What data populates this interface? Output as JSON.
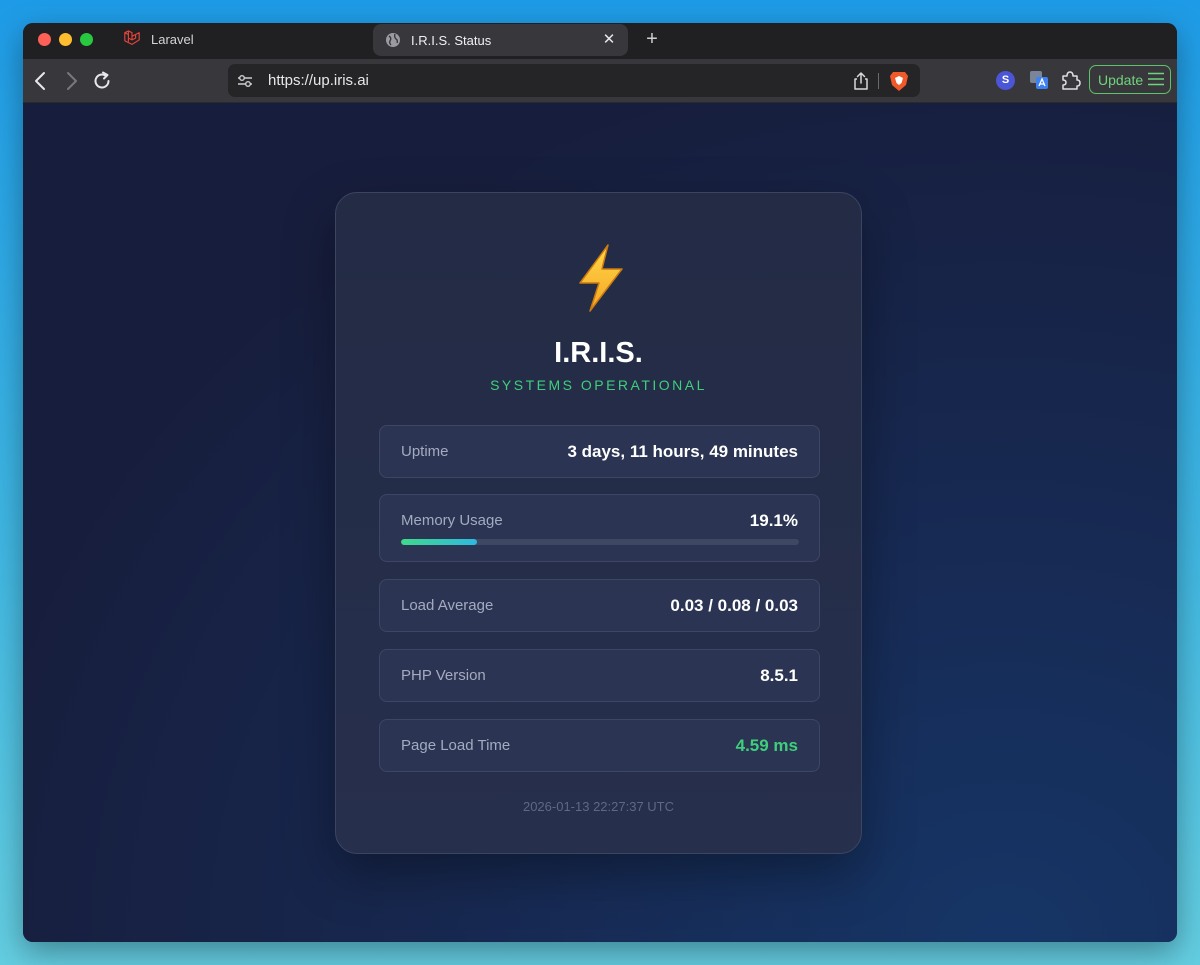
{
  "browser": {
    "tabs": [
      {
        "title": "Laravel",
        "icon": "laravel-icon",
        "active": false
      },
      {
        "title": "I.R.I.S. Status",
        "icon": "globe-icon",
        "active": true
      }
    ],
    "url": "https://up.iris.ai",
    "extension_badge": "S",
    "update_label": "Update",
    "colors": {
      "update_accent": "#5cc46a",
      "brave_orange": "#f0592a"
    }
  },
  "status": {
    "icon": "lightning-bolt-icon",
    "title": "I.R.I.S.",
    "subtitle": "SYSTEMS OPERATIONAL",
    "items": [
      {
        "label": "Uptime",
        "value": "3 days, 11 hours, 49 minutes"
      },
      {
        "label": "Memory Usage",
        "value": "19.1%",
        "percent": 19.1
      },
      {
        "label": "Load Average",
        "value": "0.03 / 0.08 / 0.03"
      },
      {
        "label": "PHP Version",
        "value": "8.5.1"
      },
      {
        "label": "Page Load Time",
        "value": "4.59 ms"
      }
    ],
    "timestamp": "2026-01-13 22:27:37 UTC",
    "colors": {
      "ok": "#3ecf7c",
      "card_bg": "#232b45",
      "page_bg": "#171e3d"
    }
  }
}
